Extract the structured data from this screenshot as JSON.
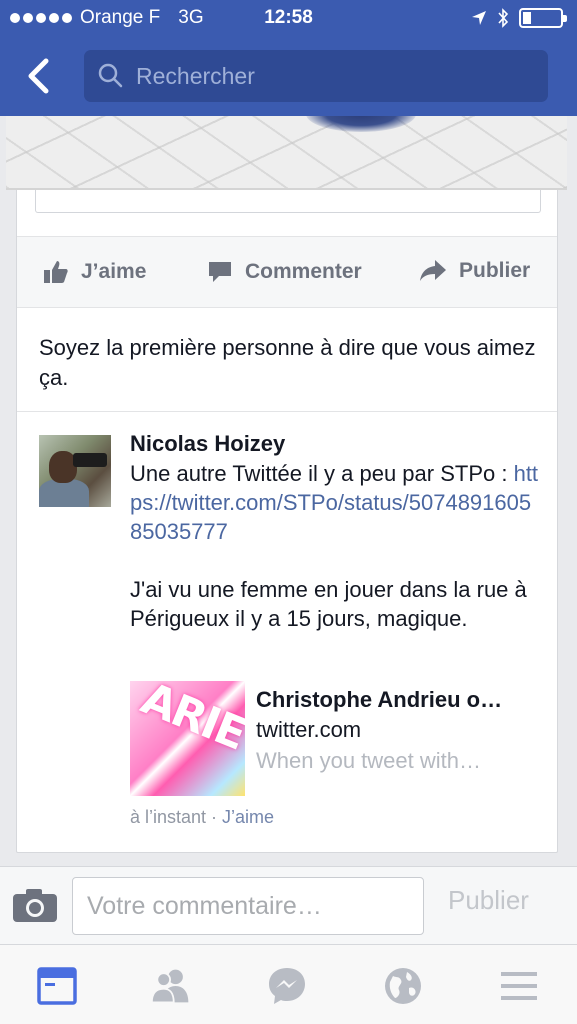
{
  "status_bar": {
    "carrier": "Orange F",
    "network": "3G",
    "time": "12:58"
  },
  "nav": {
    "search_placeholder": "Rechercher"
  },
  "actions": {
    "like": "J’aime",
    "comment": "Commenter",
    "share": "Publier"
  },
  "likes_summary": "Soyez la première personne à dire que vous aimez ça.",
  "comment": {
    "author": "Nicolas Hoizey",
    "text_before_link": "Une autre Twittée il y a peu par STPo : ",
    "link": "https://twitter.com/STPo/status/507489160585035777",
    "text_after": "J'ai vu une femme en jouer dans la rue à Périgueux il y a 15 jours, magique.",
    "share": {
      "thumb_text": "ARIE",
      "title": "Christophe Andrieu o…",
      "domain": "twitter.com",
      "description": "When you tweet with…"
    },
    "time": "à l’instant",
    "separator": " · ",
    "like_label": "J’aime"
  },
  "composer": {
    "placeholder": "Votre commentaire…",
    "publish": "Publier"
  },
  "colors": {
    "brand": "#3b5bb0",
    "link": "#4b67a1",
    "tab_active": "#4a6ee0",
    "tab_inactive": "#b8bcc4"
  },
  "tabs": [
    "feed-icon",
    "friends-icon",
    "messenger-icon",
    "globe-icon",
    "menu-icon"
  ]
}
